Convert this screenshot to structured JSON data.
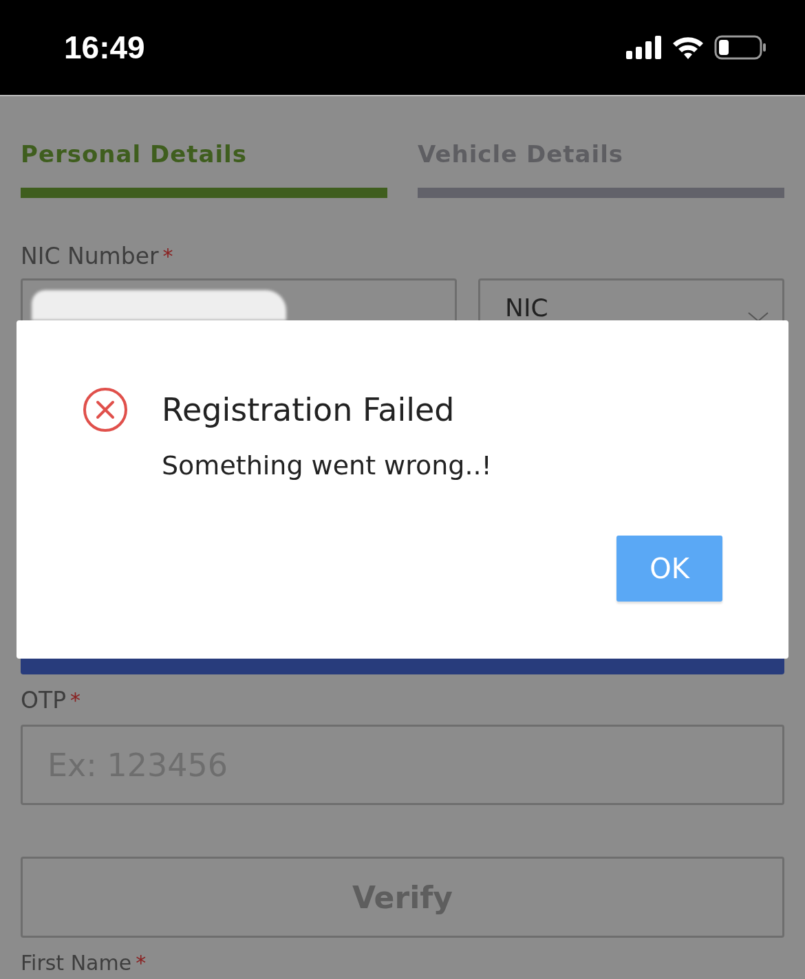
{
  "status_bar": {
    "time": "16:49"
  },
  "tabs": [
    {
      "label": "Personal Details",
      "selected": true
    },
    {
      "label": "Vehicle Details",
      "selected": false
    }
  ],
  "form": {
    "nic": {
      "label": "NIC Number",
      "mark": "*",
      "id_type": "NIC"
    },
    "otp": {
      "label": "OTP",
      "mark": "*",
      "placeholder": "Ex: 123456"
    },
    "verify_button": "Verify",
    "first_name": {
      "label": "First Name",
      "mark": "*"
    }
  },
  "dialog": {
    "kind": "error",
    "title": "Registration Failed",
    "message": "Something went wrong..!",
    "button": "OK"
  }
}
